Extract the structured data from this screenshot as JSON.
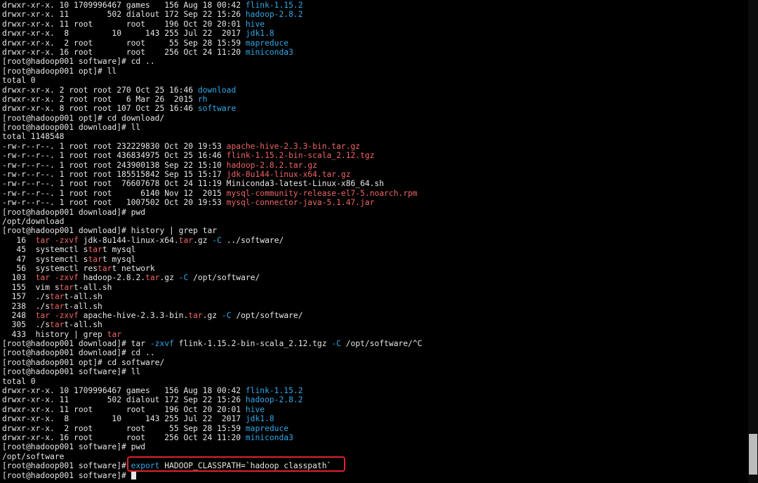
{
  "colors": {
    "text": "#e6e6e6",
    "dir": "#2fa8e8",
    "archive": "#ef6464",
    "command": "#2fa8e8",
    "grep": "#ef6464",
    "highlight_border": "#e0222a",
    "cursor": "#e6e6e6"
  },
  "terminal": {
    "lines": [
      [
        [
          "drwxr-xr-x. 10 1709996467 games   156 Aug 18 00:42 ",
          "text"
        ],
        [
          "flink-1.15.2",
          "dir"
        ]
      ],
      [
        [
          "drwxr-xr-x. 11        502 dialout 172 Sep 22 15:26 ",
          "text"
        ],
        [
          "hadoop-2.8.2",
          "dir"
        ]
      ],
      [
        [
          "drwxr-xr-x. 11 root       root    196 Oct 20 20:01 ",
          "text"
        ],
        [
          "hive",
          "dir"
        ]
      ],
      [
        [
          "drwxr-xr-x.  8         10     143 255 Jul 22  2017 ",
          "text"
        ],
        [
          "jdk1.8",
          "dir"
        ]
      ],
      [
        [
          "drwxr-xr-x.  2 root       root     55 Sep 28 15:59 ",
          "text"
        ],
        [
          "mapreduce",
          "dir"
        ]
      ],
      [
        [
          "drwxr-xr-x. 16 root       root    256 Oct 24 11:20 ",
          "text"
        ],
        [
          "miniconda3",
          "dir"
        ]
      ],
      [
        [
          "[root@hadoop001 software]# cd ..",
          "text"
        ]
      ],
      [
        [
          "[root@hadoop001 opt]# ll",
          "text"
        ]
      ],
      [
        [
          "total 0",
          "text"
        ]
      ],
      [
        [
          "drwxr-xr-x. 2 root root 270 Oct 25 16:46 ",
          "text"
        ],
        [
          "download",
          "dir"
        ]
      ],
      [
        [
          "drwxr-xr-x. 2 root root   6 Mar 26  2015 ",
          "text"
        ],
        [
          "rh",
          "dir"
        ]
      ],
      [
        [
          "drwxr-xr-x. 8 root root 107 Oct 25 16:46 ",
          "text"
        ],
        [
          "software",
          "dir"
        ]
      ],
      [
        [
          "[root@hadoop001 opt]# cd download/",
          "text"
        ]
      ],
      [
        [
          "[root@hadoop001 download]# ll",
          "text"
        ]
      ],
      [
        [
          "total 1148548",
          "text"
        ]
      ],
      [
        [
          "-rw-r--r--. 1 root root 232229830 Oct 20 19:53 ",
          "text"
        ],
        [
          "apache-hive-2.3.3-bin.tar.gz",
          "archive"
        ]
      ],
      [
        [
          "-rw-r--r--. 1 root root 436834975 Oct 25 16:46 ",
          "text"
        ],
        [
          "flink-1.15.2-bin-scala_2.12.tgz",
          "archive"
        ]
      ],
      [
        [
          "-rw-r--r--. 1 root root 243900138 Sep 22 15:10 ",
          "text"
        ],
        [
          "hadoop-2.8.2.tar.gz",
          "archive"
        ]
      ],
      [
        [
          "-rw-r--r--. 1 root root 185515842 Sep 15 15:17 ",
          "text"
        ],
        [
          "jdk-8u144-linux-x64.tar.gz",
          "archive"
        ]
      ],
      [
        [
          "-rw-r--r--. 1 root root  76607678 Oct 24 11:19 Miniconda3-latest-Linux-x86_64.sh",
          "text"
        ]
      ],
      [
        [
          "-rw-r--r--. 1 root root      6140 Nov 12  2015 ",
          "text"
        ],
        [
          "mysql-community-release-el7-5.noarch.rpm",
          "archive"
        ]
      ],
      [
        [
          "-rw-r--r--. 1 root root   1007502 Oct 20 19:53 ",
          "text"
        ],
        [
          "mysql-connector-java-5.1.47.jar",
          "archive"
        ]
      ],
      [
        [
          "[root@hadoop001 download]# pwd",
          "text"
        ]
      ],
      [
        [
          "/opt/download",
          "text"
        ]
      ],
      [
        [
          "[root@hadoop001 download]# history | grep tar",
          "text"
        ]
      ],
      [
        [
          "   16  ",
          "text"
        ],
        [
          "tar",
          "grep"
        ],
        [
          " ",
          "text"
        ],
        [
          "-zxvf",
          "grep"
        ],
        [
          " jdk-8u144-linux-x64.",
          "text"
        ],
        [
          "tar",
          "grep"
        ],
        [
          ".gz ",
          "text"
        ],
        [
          "-C",
          "command"
        ],
        [
          " ../software/",
          "text"
        ]
      ],
      [
        [
          "   45  systemctl s",
          "text"
        ],
        [
          "tar",
          "grep"
        ],
        [
          "t mysql",
          "text"
        ]
      ],
      [
        [
          "   47  systemctl s",
          "text"
        ],
        [
          "tar",
          "grep"
        ],
        [
          "t mysql",
          "text"
        ]
      ],
      [
        [
          "   56  systemctl res",
          "text"
        ],
        [
          "tar",
          "grep"
        ],
        [
          "t network",
          "text"
        ]
      ],
      [
        [
          "  103  ",
          "text"
        ],
        [
          "tar",
          "grep"
        ],
        [
          " ",
          "text"
        ],
        [
          "-zxvf",
          "grep"
        ],
        [
          " hadoop-2.8.2.",
          "text"
        ],
        [
          "tar",
          "grep"
        ],
        [
          ".gz ",
          "text"
        ],
        [
          "-C",
          "command"
        ],
        [
          " /opt/software/",
          "text"
        ]
      ],
      [
        [
          "  155  vim s",
          "text"
        ],
        [
          "tar",
          "grep"
        ],
        [
          "t-all.sh",
          "text"
        ]
      ],
      [
        [
          "  157  ./s",
          "text"
        ],
        [
          "tar",
          "grep"
        ],
        [
          "t-all.sh",
          "text"
        ]
      ],
      [
        [
          "  238  ./s",
          "text"
        ],
        [
          "tar",
          "grep"
        ],
        [
          "t-all.sh",
          "text"
        ]
      ],
      [
        [
          "  248  ",
          "text"
        ],
        [
          "tar",
          "grep"
        ],
        [
          " ",
          "text"
        ],
        [
          "-zxvf",
          "grep"
        ],
        [
          " apache-hive-2.3.3-bin.",
          "text"
        ],
        [
          "tar",
          "grep"
        ],
        [
          ".gz ",
          "text"
        ],
        [
          "-C",
          "command"
        ],
        [
          " /opt/software/",
          "text"
        ]
      ],
      [
        [
          "  305  ./s",
          "text"
        ],
        [
          "tar",
          "grep"
        ],
        [
          "t-all.sh",
          "text"
        ]
      ],
      [
        [
          "  433  history | grep ",
          "text"
        ],
        [
          "tar",
          "grep"
        ]
      ],
      [
        [
          "[root@hadoop001 download]# tar ",
          "text"
        ],
        [
          "-zxvf",
          "command"
        ],
        [
          " flink-1.15.2-bin-scala_2.12.tgz ",
          "text"
        ],
        [
          "-C",
          "command"
        ],
        [
          " /opt/software/^C",
          "text"
        ]
      ],
      [
        [
          "[root@hadoop001 download]# cd ..",
          "text"
        ]
      ],
      [
        [
          "[root@hadoop001 opt]# cd software/",
          "text"
        ]
      ],
      [
        [
          "[root@hadoop001 software]# ll",
          "text"
        ]
      ],
      [
        [
          "total 0",
          "text"
        ]
      ],
      [
        [
          "drwxr-xr-x. 10 1709996467 games   156 Aug 18 00:42 ",
          "text"
        ],
        [
          "flink-1.15.2",
          "dir"
        ]
      ],
      [
        [
          "drwxr-xr-x. 11        502 dialout 172 Sep 22 15:26 ",
          "text"
        ],
        [
          "hadoop-2.8.2",
          "dir"
        ]
      ],
      [
        [
          "drwxr-xr-x. 11 root       root    196 Oct 20 20:01 ",
          "text"
        ],
        [
          "hive",
          "dir"
        ]
      ],
      [
        [
          "drwxr-xr-x.  8         10     143 255 Jul 22  2017 ",
          "text"
        ],
        [
          "jdk1.8",
          "dir"
        ]
      ],
      [
        [
          "drwxr-xr-x.  2 root       root     55 Sep 28 15:59 ",
          "text"
        ],
        [
          "mapreduce",
          "dir"
        ]
      ],
      [
        [
          "drwxr-xr-x. 16 root       root    256 Oct 24 11:20 ",
          "text"
        ],
        [
          "miniconda3",
          "dir"
        ]
      ],
      [
        [
          "[root@hadoop001 software]# pwd",
          "text"
        ]
      ],
      [
        [
          "/opt/software",
          "text"
        ]
      ],
      [
        [
          "[root@hadoop001 software]# ",
          "text"
        ],
        [
          "export",
          "command"
        ],
        [
          " HADOOP_CLASSPATH=`hadoop classpath`",
          "text"
        ]
      ],
      [
        [
          "[root@hadoop001 software]# ",
          "text"
        ]
      ]
    ],
    "highlighted_line": 49,
    "cursor_line": 50,
    "cursor_icon": "block-cursor-icon",
    "scrollbar_icon": "vertical-scrollbar-icon"
  }
}
